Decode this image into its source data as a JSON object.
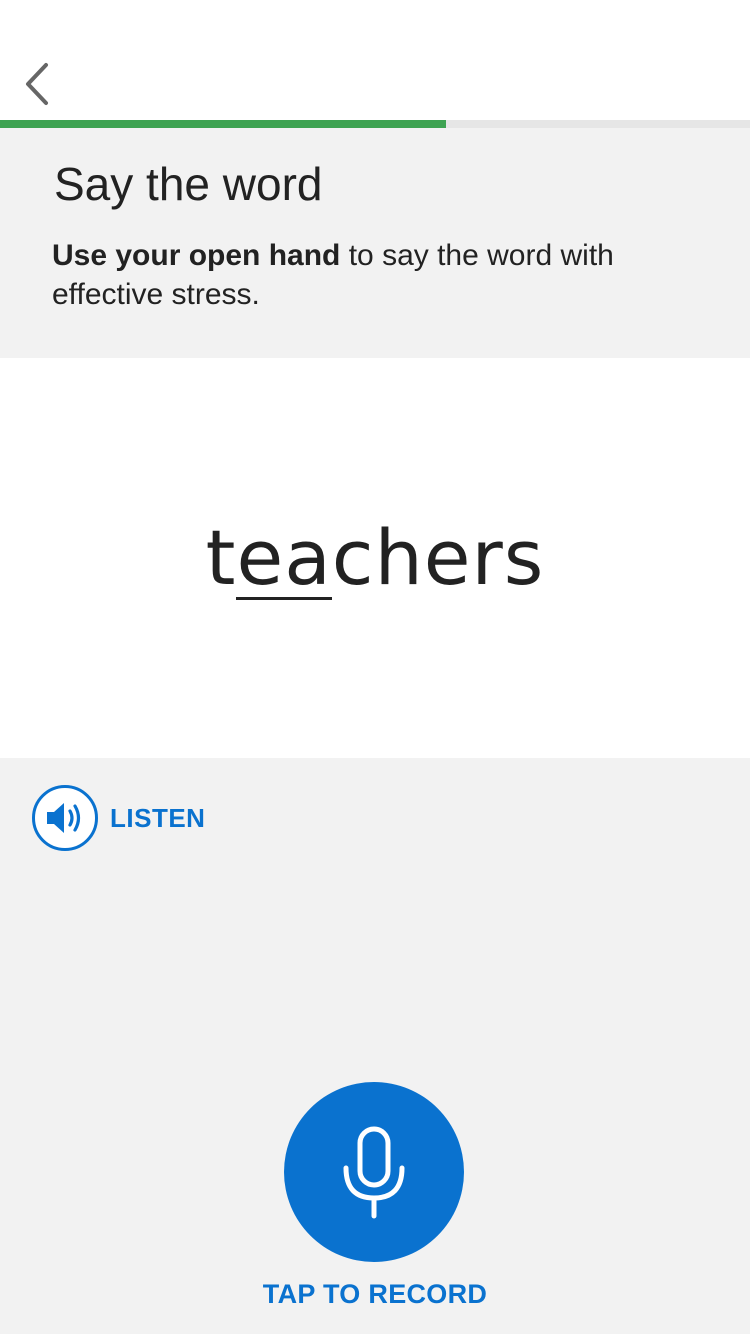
{
  "header": {
    "back_icon": "chevron-left-icon"
  },
  "progress": {
    "fraction": 0.595,
    "color": "#3ea352",
    "track_color": "#e6e6e6"
  },
  "instructions": {
    "title": "Say the word",
    "bold_text": "Use your open hand",
    "rest_text": " to say the word with effective stress."
  },
  "word": {
    "prefix": "t",
    "stressed": "ea",
    "suffix": "chers"
  },
  "listen": {
    "icon": "speaker-icon",
    "label": "LISTEN"
  },
  "record": {
    "icon": "microphone-icon",
    "label": "TAP TO RECORD"
  },
  "colors": {
    "accent": "#0a72cf",
    "panel_bg": "#f2f2f2",
    "text": "#222222"
  }
}
